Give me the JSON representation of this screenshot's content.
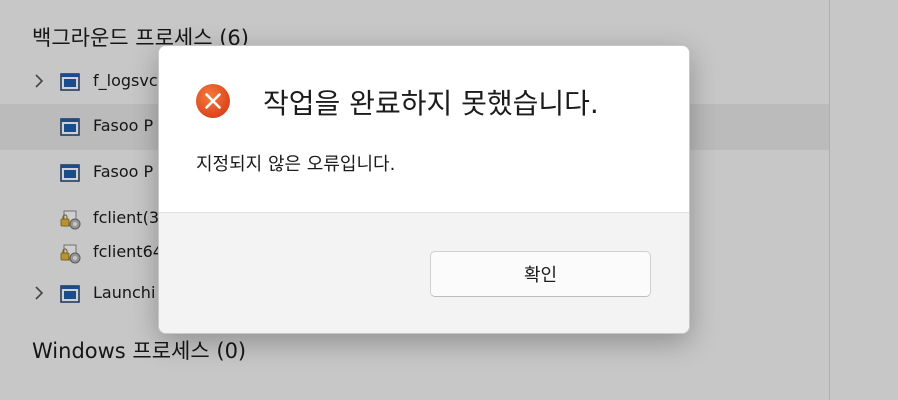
{
  "background": {
    "section_background_title": "백그라운드 프로세스 (6)",
    "processes": [
      {
        "label": "f_logsvc",
        "icon": "app-window-icon",
        "expandable": true
      },
      {
        "label": "Fasoo P",
        "icon": "app-window-icon",
        "expandable": false
      },
      {
        "label": "Fasoo P",
        "icon": "app-window-icon",
        "expandable": false
      },
      {
        "label": "fclient(3",
        "icon": "lock-doc-gear-icon",
        "expandable": false
      },
      {
        "label": "fclient64",
        "icon": "lock-doc-gear-icon",
        "expandable": false
      },
      {
        "label": "Launchi",
        "icon": "app-window-icon",
        "expandable": true
      }
    ],
    "section_windows_title": "Windows 프로세스 (0)"
  },
  "dialog": {
    "title": "작업을 완료하지 못했습니다.",
    "message": "지정되지 않은 오류입니다.",
    "ok_label": "확인",
    "icon": "error-icon"
  },
  "colors": {
    "error_red": "#e4501c",
    "accent_blue": "#1f5fae"
  }
}
